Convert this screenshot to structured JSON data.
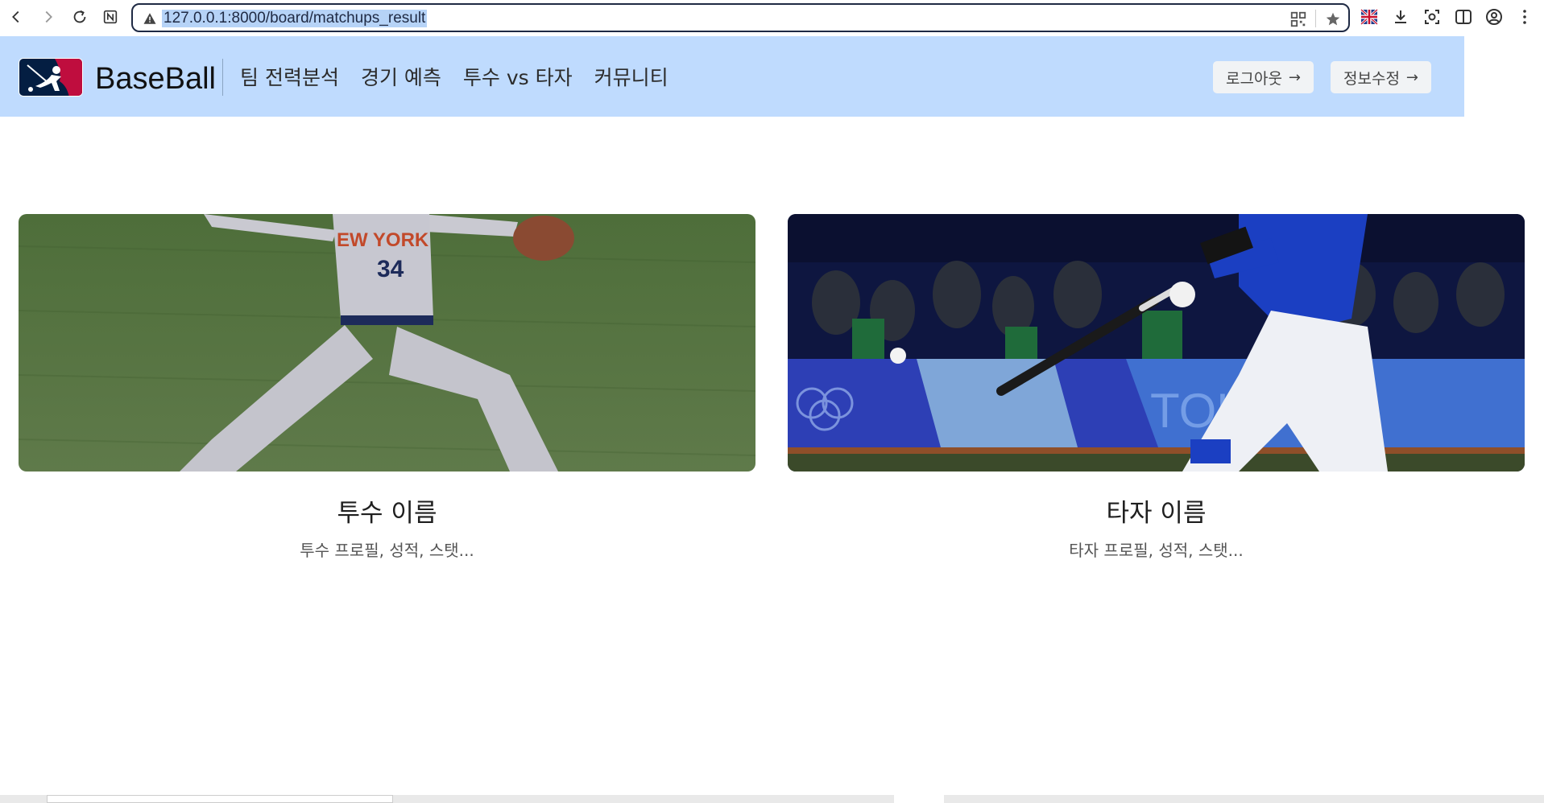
{
  "browser": {
    "url": "127.0.0.1:8000/board/matchups_result"
  },
  "header": {
    "brand": "BaseBall",
    "menu": [
      {
        "label": "팀 전력분석"
      },
      {
        "label": "경기 예측"
      },
      {
        "label": "투수 vs 타자"
      },
      {
        "label": "커뮤니티"
      }
    ],
    "logout_label": "로그아웃",
    "edit_profile_label": "정보수정",
    "arrow": "→"
  },
  "cards": [
    {
      "name": "투수 이름",
      "description": "투수 프로필, 성적, 스탯..."
    },
    {
      "name": "타자 이름",
      "description": "타자 프로필, 성적, 스탯..."
    }
  ],
  "colors": {
    "header_bg": "#bfdbfe",
    "logo_blue": "#041e42",
    "logo_red": "#bf0d3e"
  }
}
